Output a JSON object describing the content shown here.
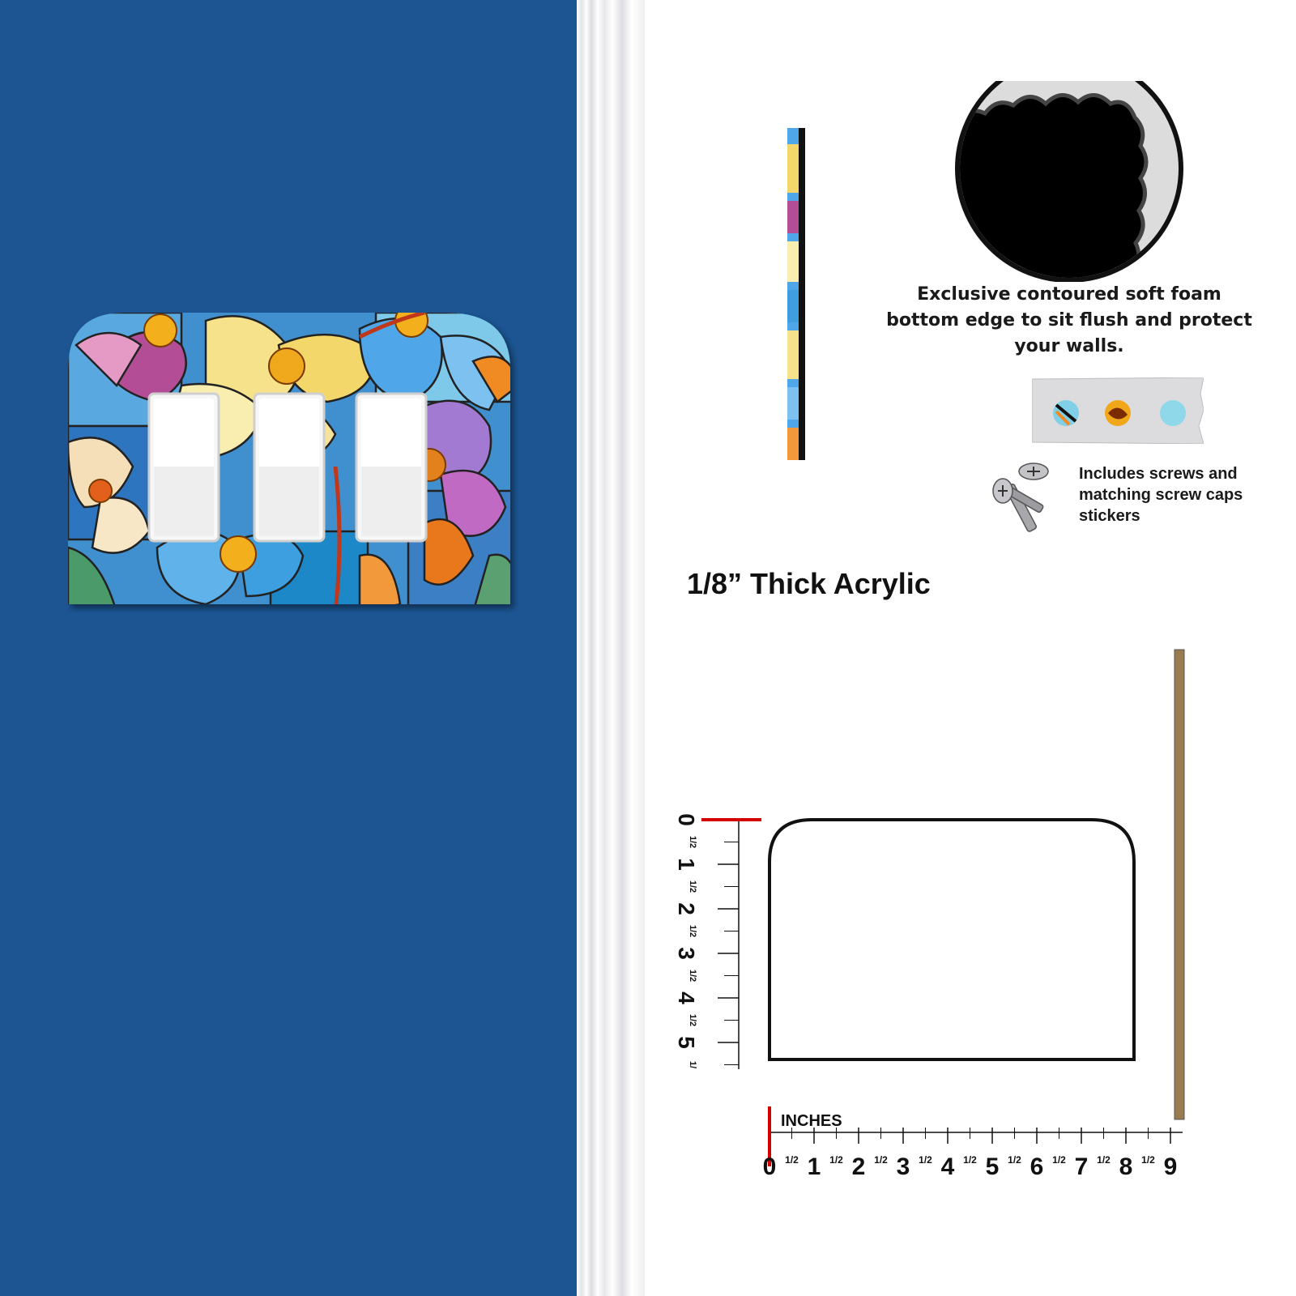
{
  "colors": {
    "wall": "#1c5592",
    "ruler_zero_mark": "#d40000",
    "depth_bar": "#9a7b4f"
  },
  "product": {
    "type": "triple rocker switch plate",
    "rocker_openings": 3,
    "pattern": "stained glass flowers"
  },
  "features": {
    "foam_caption": "Exclusive contoured soft foam bottom edge to sit flush and protect your walls.",
    "screws_caption": "Includes screws and matching screw caps stickers",
    "thickness_label": "1/8” Thick Acrylic",
    "icons": [
      "foam-edge-closeup-icon",
      "screw-cap-stickers-icon",
      "screws-icon"
    ]
  },
  "dimension_diagram": {
    "units_label": "INCHES",
    "horizontal_ruler": {
      "major_labels": [
        "0",
        "1",
        "2",
        "3",
        "4",
        "5",
        "6",
        "7",
        "8",
        "9"
      ],
      "half_label": "1/2"
    },
    "vertical_ruler": {
      "major_labels": [
        "0",
        "1",
        "2",
        "3",
        "4",
        "5"
      ],
      "half_label": "1/2",
      "end_label": "1/"
    }
  }
}
